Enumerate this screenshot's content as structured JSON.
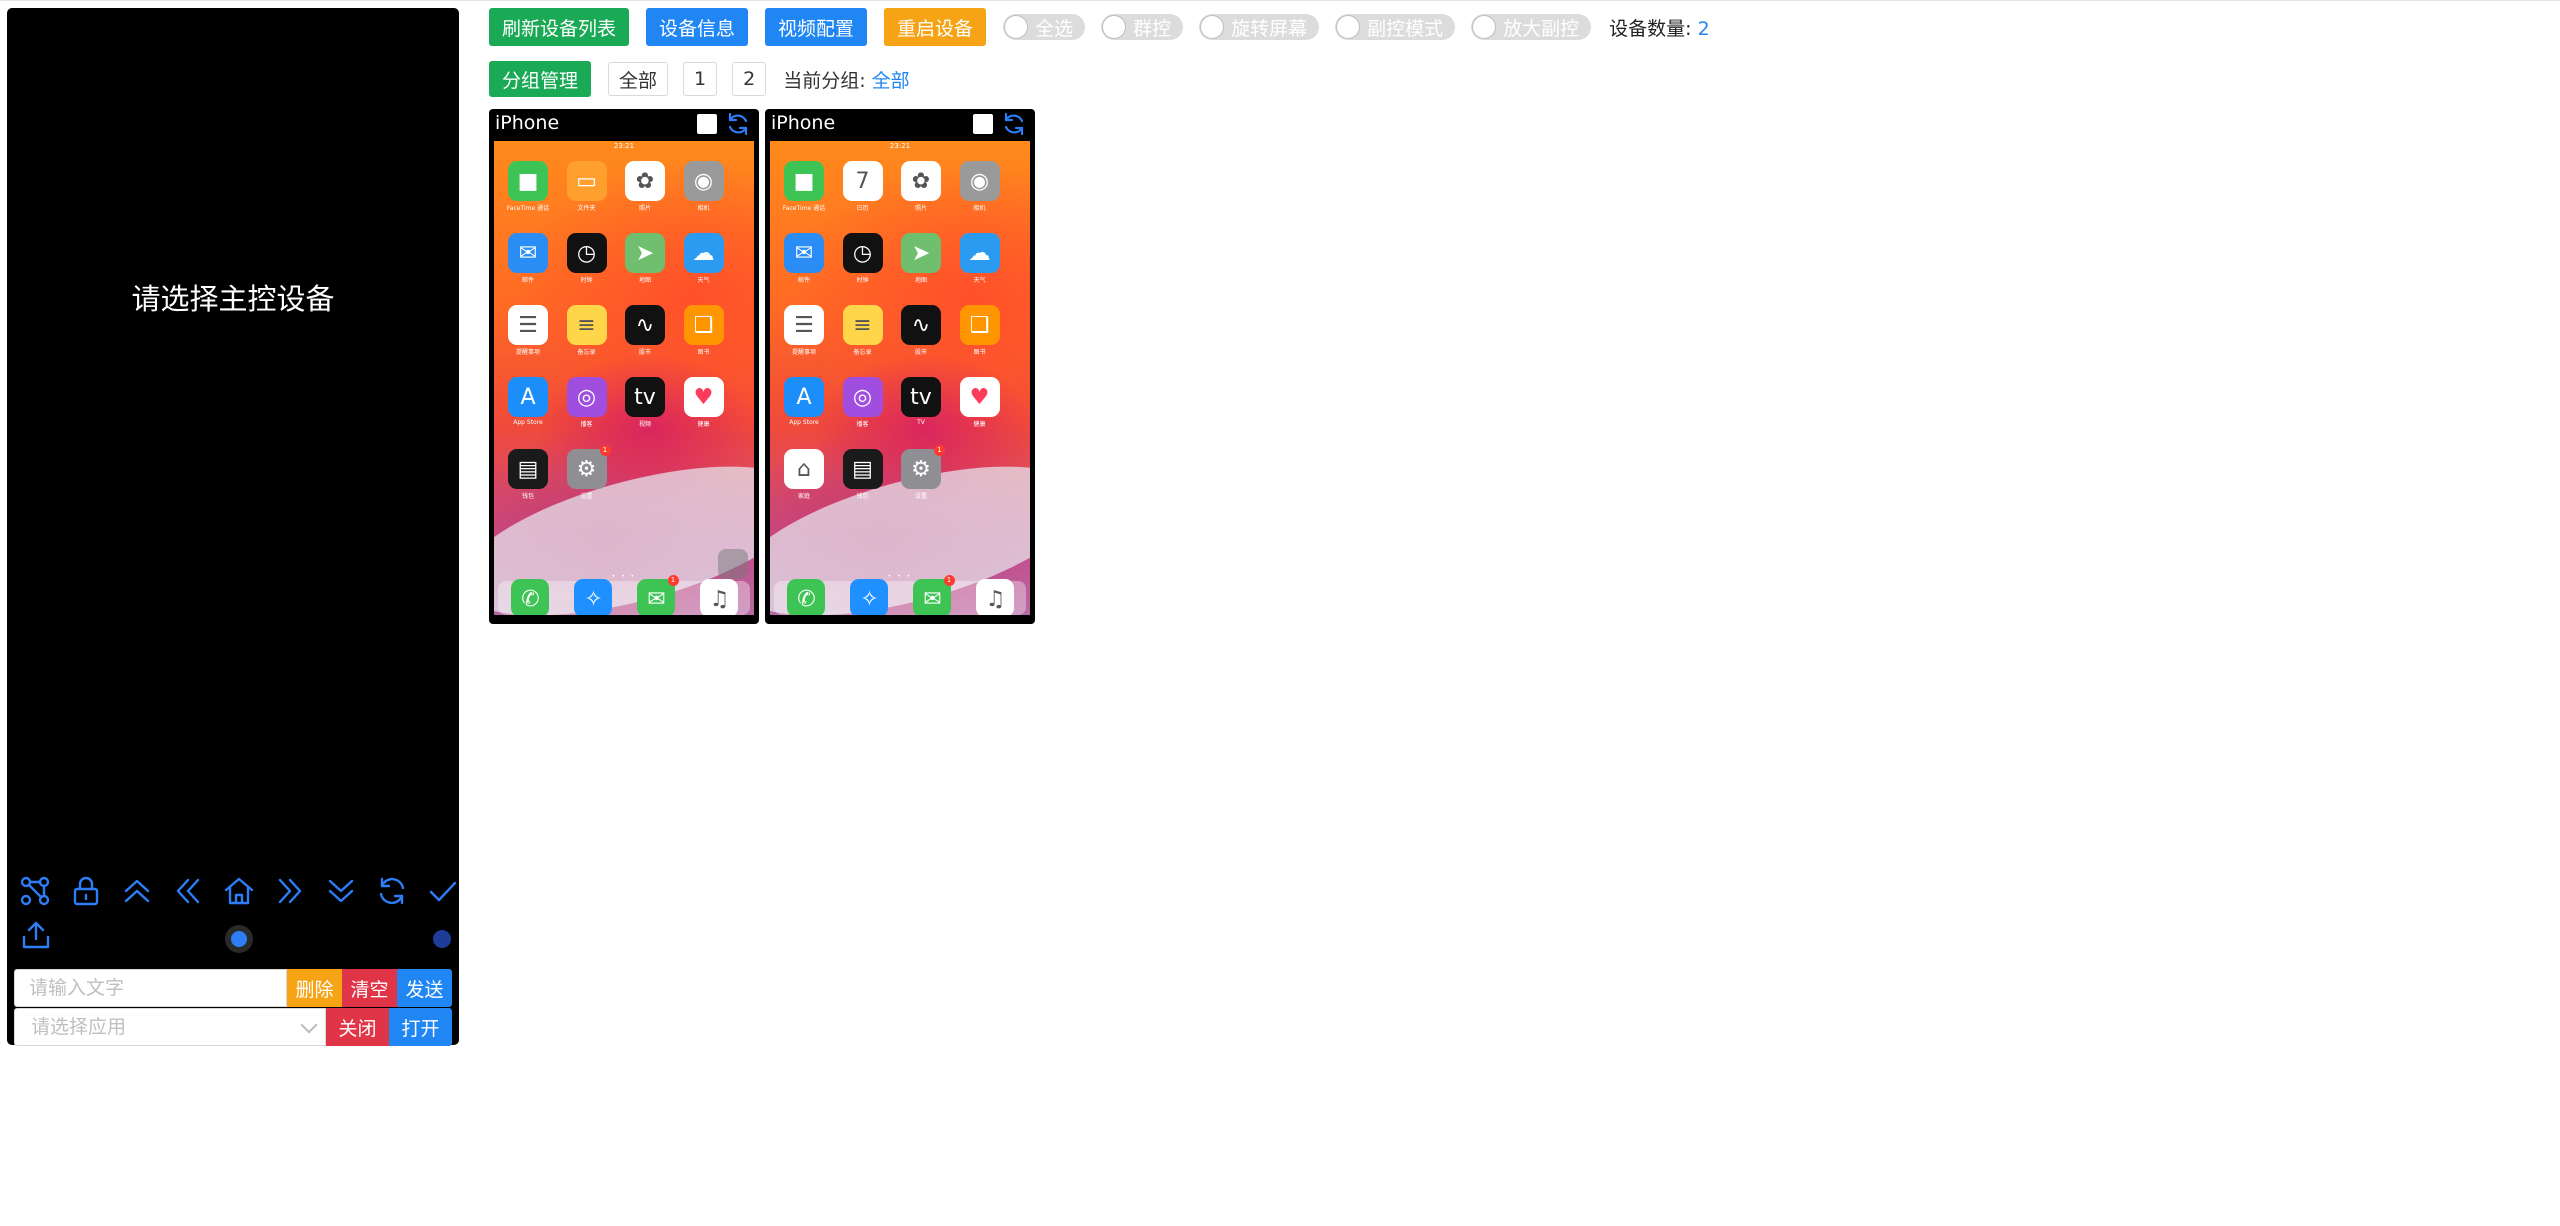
{
  "master": {
    "hint": "请选择主控设备",
    "text_placeholder": "请输入文字",
    "app_placeholder": "请选择应用",
    "delete_label": "删除",
    "clear_label": "清空",
    "send_label": "发送",
    "close_label": "关闭",
    "open_label": "打开",
    "controls": [
      "nodes-icon",
      "lock-icon",
      "double-up-icon",
      "double-left-icon",
      "home-icon",
      "double-right-icon",
      "double-down-icon",
      "sync-icon",
      "check-icon"
    ]
  },
  "toolbar": {
    "refresh_list": "刷新设备列表",
    "device_info": "设备信息",
    "video_config": "视频配置",
    "restart_device": "重启设备",
    "switches": {
      "select_all": "全选",
      "group_control": "群控",
      "rotate_screen": "旋转屏幕",
      "sub_control_mode": "副控模式",
      "zoom_sub_control": "放大副控"
    },
    "device_count_label": "设备数量:",
    "device_count": "2",
    "group_manage": "分组管理",
    "groups": [
      "全部",
      "1",
      "2"
    ],
    "current_group_label": "当前分组:",
    "current_group": "全部"
  },
  "devices": [
    {
      "name": "iPhone",
      "time": "23:21",
      "apps": [
        {
          "label": "FaceTime 通话",
          "icon": "facetime-icon",
          "color": "#3ec455"
        },
        {
          "label": "文件夹",
          "icon": "folder-icon",
          "color": "#ff9f2e"
        },
        {
          "label": "照片",
          "icon": "photos-icon",
          "color": "#ffffff"
        },
        {
          "label": "相机",
          "icon": "camera-icon",
          "color": "#9a9a9a"
        },
        {
          "label": "邮件",
          "icon": "mail-icon",
          "color": "#2a8cf5"
        },
        {
          "label": "时钟",
          "icon": "clock-icon",
          "color": "#111111"
        },
        {
          "label": "地图",
          "icon": "maps-icon",
          "color": "#6fbf6f"
        },
        {
          "label": "天气",
          "icon": "weather-icon",
          "color": "#2a9bf0"
        },
        {
          "label": "提醒事项",
          "icon": "reminders-icon",
          "color": "#ffffff"
        },
        {
          "label": "备忘录",
          "icon": "notes-icon",
          "color": "#ffd54a"
        },
        {
          "label": "股市",
          "icon": "stocks-icon",
          "color": "#111111"
        },
        {
          "label": "图书",
          "icon": "books-icon",
          "color": "#ff9500"
        },
        {
          "label": "App Store",
          "icon": "appstore-icon",
          "color": "#1c8ef9"
        },
        {
          "label": "播客",
          "icon": "podcasts-icon",
          "color": "#a04ee0"
        },
        {
          "label": "视频",
          "icon": "tv-icon",
          "color": "#111111"
        },
        {
          "label": "健康",
          "icon": "health-icon",
          "color": "#ffffff"
        },
        {
          "label": "钱包",
          "icon": "wallet-icon",
          "color": "#1a1a1a"
        },
        {
          "label": "设置",
          "icon": "settings-icon",
          "color": "#8e8e93",
          "badge": "1"
        }
      ],
      "dock": [
        {
          "icon": "phone-icon",
          "color": "#3ec455"
        },
        {
          "icon": "safari-icon",
          "color": "#1e90ff"
        },
        {
          "icon": "messages-icon",
          "color": "#3ec455",
          "badge": "1"
        },
        {
          "icon": "music-icon",
          "color": "#ffffff"
        }
      ]
    },
    {
      "name": "iPhone",
      "time": "23:21",
      "apps": [
        {
          "label": "FaceTime 通话",
          "icon": "facetime-icon",
          "color": "#3ec455"
        },
        {
          "label": "日历",
          "icon": "calendar-icon",
          "color": "#ffffff"
        },
        {
          "label": "照片",
          "icon": "photos-icon",
          "color": "#ffffff"
        },
        {
          "label": "相机",
          "icon": "camera-icon",
          "color": "#9a9a9a"
        },
        {
          "label": "邮件",
          "icon": "mail-icon",
          "color": "#2a8cf5"
        },
        {
          "label": "时钟",
          "icon": "clock-icon",
          "color": "#111111"
        },
        {
          "label": "地图",
          "icon": "maps-icon",
          "color": "#6fbf6f"
        },
        {
          "label": "天气",
          "icon": "weather-icon",
          "color": "#2a9bf0"
        },
        {
          "label": "提醒事项",
          "icon": "reminders-icon",
          "color": "#ffffff"
        },
        {
          "label": "备忘录",
          "icon": "notes-icon",
          "color": "#ffd54a"
        },
        {
          "label": "股市",
          "icon": "stocks-icon",
          "color": "#111111"
        },
        {
          "label": "图书",
          "icon": "books-icon",
          "color": "#ff9500"
        },
        {
          "label": "App Store",
          "icon": "appstore-icon",
          "color": "#1c8ef9"
        },
        {
          "label": "播客",
          "icon": "podcasts-icon",
          "color": "#a04ee0"
        },
        {
          "label": "TV",
          "icon": "tv-icon",
          "color": "#111111"
        },
        {
          "label": "健康",
          "icon": "health-icon",
          "color": "#ffffff"
        },
        {
          "label": "家庭",
          "icon": "home-app-icon",
          "color": "#ffffff"
        },
        {
          "label": "钱包",
          "icon": "wallet-icon",
          "color": "#1a1a1a"
        },
        {
          "label": "设置",
          "icon": "settings-icon",
          "color": "#8e8e93",
          "badge": "1"
        }
      ],
      "dock": [
        {
          "icon": "phone-icon",
          "color": "#3ec455"
        },
        {
          "icon": "safari-icon",
          "color": "#1e90ff"
        },
        {
          "icon": "messages-icon",
          "color": "#3ec455",
          "badge": "1"
        },
        {
          "icon": "music-icon",
          "color": "#ffffff"
        }
      ]
    }
  ],
  "colors": {
    "accent_blue": "#1f86f3",
    "green": "#1aaa55",
    "orange": "#f7a316",
    "red": "#e03546",
    "icon_blue": "#2d7df6"
  }
}
